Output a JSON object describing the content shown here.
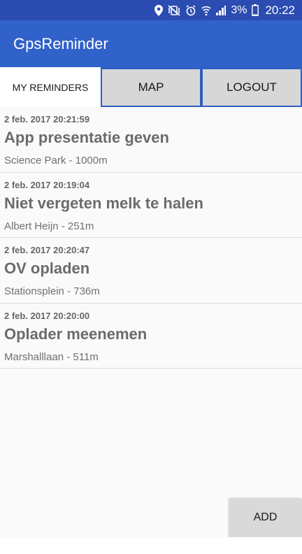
{
  "status_bar": {
    "battery": "3%",
    "time": "20:22",
    "icons": [
      "location-icon",
      "vibrate-mute-icon",
      "alarm-icon",
      "wifi-calling-icon",
      "signal-icon",
      "battery-icon"
    ]
  },
  "app": {
    "title": "GpsReminder",
    "colors": {
      "status_bar": "#2b4cb0",
      "app_bar": "#3162c9",
      "button": "#d7d7d7"
    }
  },
  "tabs": {
    "my_reminders": "MY REMINDERS",
    "map": "MAP",
    "logout": "LOGOUT"
  },
  "reminders": [
    {
      "date": "2 feb. 2017 20:21:59",
      "title": "App presentatie geven",
      "location": "Science Park - 1000m"
    },
    {
      "date": "2 feb. 2017 20:19:04",
      "title": "Niet vergeten melk te halen",
      "location": "Albert Heijn - 251m"
    },
    {
      "date": "2 feb. 2017 20:20:47",
      "title": "OV opladen",
      "location": "Stationsplein - 736m"
    },
    {
      "date": "2 feb. 2017 20:20:00",
      "title": "Oplader meenemen",
      "location": "Marshalllaan - 511m"
    }
  ],
  "actions": {
    "add": "ADD"
  }
}
